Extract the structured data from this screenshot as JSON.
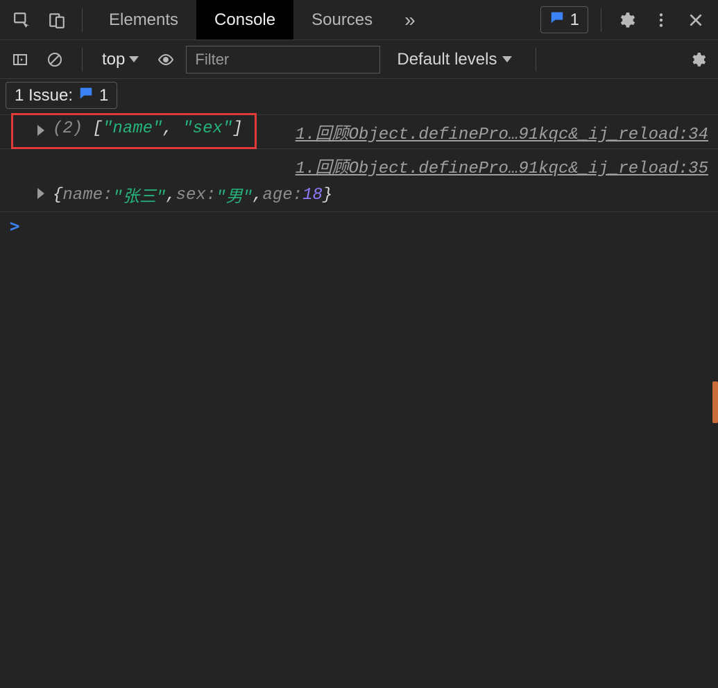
{
  "topbar": {
    "tabs": {
      "elements": "Elements",
      "console": "Console",
      "sources": "Sources"
    },
    "overflow_glyph": "»",
    "issue_count": "1"
  },
  "filterbar": {
    "context": "top",
    "filter_placeholder": "Filter",
    "levels_label": "Default levels"
  },
  "issues_row": {
    "label": "1 Issue:",
    "count": "1"
  },
  "logs": {
    "row1": {
      "count": "(2)",
      "open": " [",
      "v1": "\"name\"",
      "comma": ", ",
      "v2": "\"sex\"",
      "close": "]",
      "source": "1.回顾Object.definePro…91kqc&_ij_reload:34"
    },
    "row2": {
      "source": "1.回顾Object.definePro…91kqc&_ij_reload:35",
      "brace_open": "{",
      "k1": "name:",
      "v1": " \"张三\"",
      "sep1": ", ",
      "k2": "sex:",
      "v2": " \"男\"",
      "sep2": ", ",
      "k3": "age:",
      "v3": " 18",
      "brace_close": "}"
    }
  },
  "prompt": ">"
}
